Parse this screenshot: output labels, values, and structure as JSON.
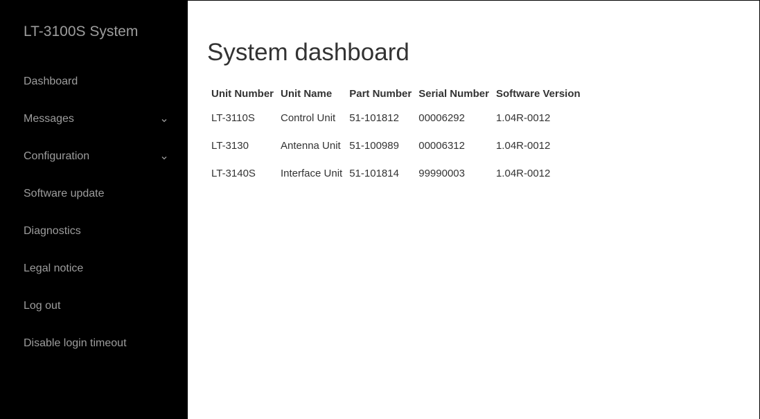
{
  "sidebar": {
    "brand": "LT-3100S System",
    "items": [
      {
        "label": "Dashboard",
        "has_submenu": false
      },
      {
        "label": "Messages",
        "has_submenu": true
      },
      {
        "label": "Configuration",
        "has_submenu": true
      },
      {
        "label": "Software update",
        "has_submenu": false
      },
      {
        "label": "Diagnostics",
        "has_submenu": false
      },
      {
        "label": "Legal notice",
        "has_submenu": false
      },
      {
        "label": "Log out",
        "has_submenu": false
      },
      {
        "label": "Disable login timeout",
        "has_submenu": false
      }
    ]
  },
  "main": {
    "title": "System dashboard",
    "table": {
      "headers": [
        "Unit Number",
        "Unit Name",
        "Part Number",
        "Serial Number",
        "Software Version"
      ],
      "rows": [
        [
          "LT-3110S",
          "Control Unit",
          "51-101812",
          "00006292",
          "1.04R-0012"
        ],
        [
          "LT-3130",
          "Antenna Unit",
          "51-100989",
          "00006312",
          "1.04R-0012"
        ],
        [
          "LT-3140S",
          "Interface Unit",
          "51-101814",
          "99990003",
          "1.04R-0012"
        ]
      ]
    }
  },
  "colors": {
    "sidebar_bg": "#000000",
    "sidebar_text": "#9d9d9d",
    "main_text": "#333333",
    "page_bg": "#ffffff"
  }
}
